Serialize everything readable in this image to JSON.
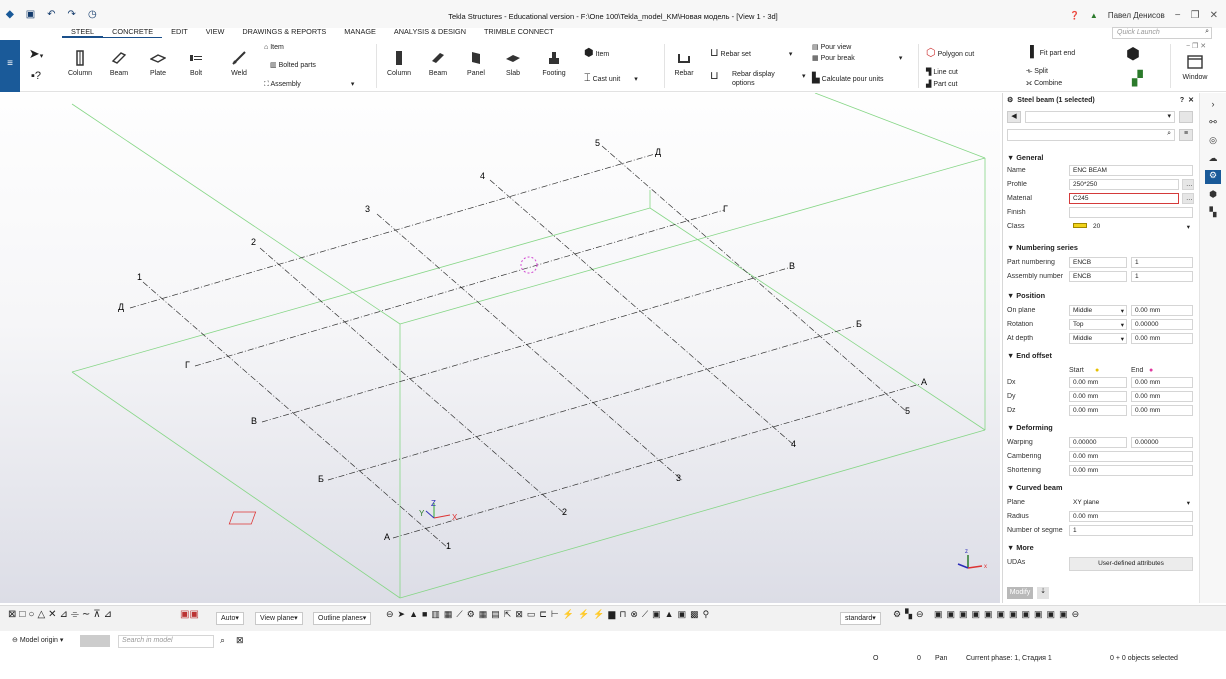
{
  "app": {
    "title": "Tekla Structures - Educational version - F:\\One 100\\Tekla_model_KM\\Новая модель - [View 1 - 3d]",
    "user": "Павел Денисов",
    "quick_launch_placeholder": "Quick Launch"
  },
  "menu": [
    "STEEL",
    "CONCRETE",
    "EDIT",
    "VIEW",
    "DRAWINGS & REPORTS",
    "MANAGE",
    "ANALYSIS & DESIGN",
    "TRIMBLE CONNECT"
  ],
  "ribbon": {
    "steel": [
      "Column",
      "Beam",
      "Plate",
      "Bolt",
      "Weld"
    ],
    "steel_small": {
      "item": "Item",
      "bolted": "Bolted parts",
      "assembly": "Assembly"
    },
    "concrete": [
      "Column",
      "Beam",
      "Panel",
      "Slab",
      "Footing"
    ],
    "concrete_small": {
      "item": "Item",
      "cast_unit": "Cast unit"
    },
    "rebar": {
      "rebar": "Rebar",
      "rebar_set": "Rebar set",
      "rebar_display": "Rebar display options"
    },
    "pour": {
      "pour_view": "Pour view",
      "pour_break": "Pour break",
      "calc": "Calculate pour units"
    },
    "edit": {
      "polygon_cut": "Polygon cut",
      "line_cut": "Line cut",
      "part_cut": "Part cut",
      "fit_part_end": "Fit part end",
      "split": "Split",
      "combine": "Combine"
    },
    "window": "Window"
  },
  "viewport": {
    "axes_num": [
      "1",
      "2",
      "3",
      "4",
      "5"
    ],
    "axes_letters": [
      "А",
      "Б",
      "В",
      "Г",
      "Д"
    ],
    "coord": {
      "x": "X",
      "y": "Y",
      "z": "Z"
    }
  },
  "panel": {
    "title": "Steel beam (1 selected)",
    "general": "General",
    "name_label": "Name",
    "name": "ENC BEAM",
    "profile_label": "Profile",
    "profile": "250*250",
    "material_label": "Material",
    "material": "C245",
    "finish_label": "Finish",
    "finish": "",
    "class_label": "Class",
    "class": "20",
    "numbering": "Numbering series",
    "part_num_label": "Part numbering",
    "part_prefix": "ENCB",
    "part_start": "1",
    "asm_num_label": "Assembly number",
    "asm_prefix": "ENCB",
    "asm_start": "1",
    "position": "Position",
    "on_plane_label": "On plane",
    "on_plane": "Middle",
    "on_plane_val": "0.00 mm",
    "rotation_label": "Rotation",
    "rotation": "Top",
    "rotation_val": "0.00000",
    "at_depth_label": "At depth",
    "at_depth": "Middle",
    "at_depth_val": "0.00 mm",
    "end_offset": "End offset",
    "start": "Start",
    "end": "End",
    "dx_label": "Dx",
    "dx_start": "0.00 mm",
    "dx_end": "0.00 mm",
    "dy_label": "Dy",
    "dy_start": "0.00 mm",
    "dy_end": "0.00 mm",
    "dz_label": "Dz",
    "dz_start": "0.00 mm",
    "dz_end": "0.00 mm",
    "deforming": "Deforming",
    "warping_label": "Warping",
    "warping_start": "0.00000",
    "warping_end": "0.00000",
    "cambering_label": "Cambering",
    "cambering": "0.00 mm",
    "shortening_label": "Shortening",
    "shortening": "0.00 mm",
    "curved": "Curved beam",
    "plane_label": "Plane",
    "plane": "XY plane",
    "radius_label": "Radius",
    "radius": "0.00 mm",
    "segments_label": "Number of segme",
    "segments": "1",
    "more": "More",
    "udas_label": "UDAs",
    "udas_button": "User-defined attributes",
    "modify_button": "Modify"
  },
  "statusbar": {
    "auto": "Auto",
    "view_plane": "View plane",
    "outline_planes": "Outline planes",
    "standard": "standard",
    "model_origin": "Model origin",
    "search_placeholder": "Search in model",
    "o1": "O",
    "o2": "0",
    "pan": "Pan",
    "phase": "Current phase: 1, Стадия 1",
    "selected": "0 + 0 objects selected"
  },
  "colors": {
    "accent": "#1a5a99",
    "grid_green": "#7ed67e",
    "material_border": "#d43a3a"
  }
}
